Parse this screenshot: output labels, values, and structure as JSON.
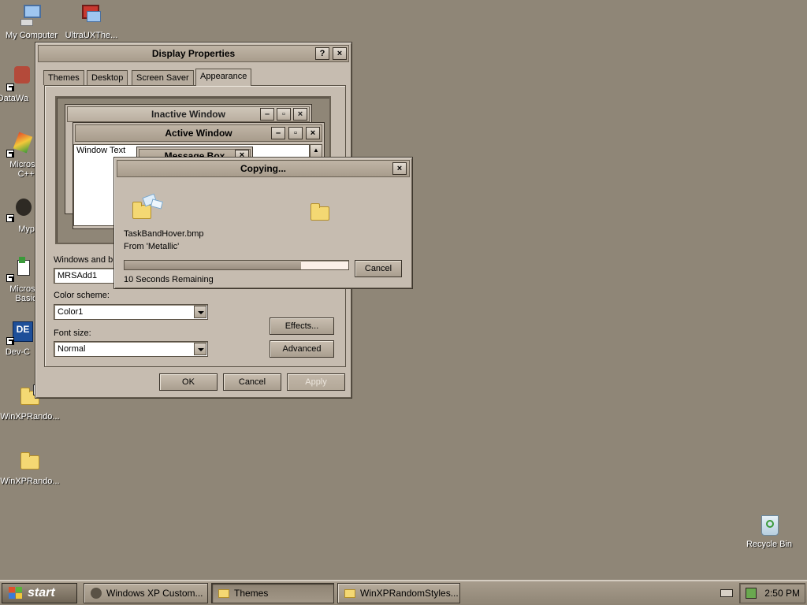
{
  "desktop": {
    "icons": [
      {
        "label": "My Computer"
      },
      {
        "label": "UltraUXThe..."
      },
      {
        "label": "DataWa"
      },
      {
        "label": "Microsof C++"
      },
      {
        "label": "Myp"
      },
      {
        "label": "Microsof Basic"
      },
      {
        "label": "Dev-C"
      },
      {
        "label": "WinXPRando..."
      },
      {
        "label": "WinXPRando..."
      },
      {
        "label": "Recycle Bin"
      }
    ]
  },
  "display_properties": {
    "title": "Display Properties",
    "help_btn": "?",
    "close_btn": "×",
    "tabs": [
      "Themes",
      "Desktop",
      "Screen Saver",
      "Appearance"
    ],
    "active_tab": "Appearance",
    "preview": {
      "inactive_title": "Inactive Window",
      "active_title": "Active Window",
      "window_text": "Window Text",
      "message_box": "Message Box"
    },
    "windows_buttons_label": "Windows and bu",
    "windows_buttons_value": "MRSAdd1",
    "color_scheme_label": "Color scheme:",
    "color_scheme_value": "Color1",
    "font_size_label": "Font size:",
    "font_size_value": "Normal",
    "effects_btn": "Effects...",
    "advanced_btn": "Advanced",
    "ok_btn": "OK",
    "cancel_btn": "Cancel",
    "apply_btn": "Apply"
  },
  "copying": {
    "title": "Copying...",
    "filename": "TaskBandHover.bmp",
    "from": "From 'Metallic'",
    "progress": 0.79,
    "remaining": "10 Seconds Remaining",
    "cancel_btn": "Cancel"
  },
  "taskbar": {
    "start_label": "start",
    "tasks": [
      {
        "label": "Windows XP Custom..."
      },
      {
        "label": "Themes"
      },
      {
        "label": "WinXPRandomStyles..."
      }
    ],
    "clock": "2:50 PM"
  },
  "colors": {
    "desktop": "#8f8677",
    "window": "#c6bcb0",
    "progress_fill": "#a39688"
  }
}
